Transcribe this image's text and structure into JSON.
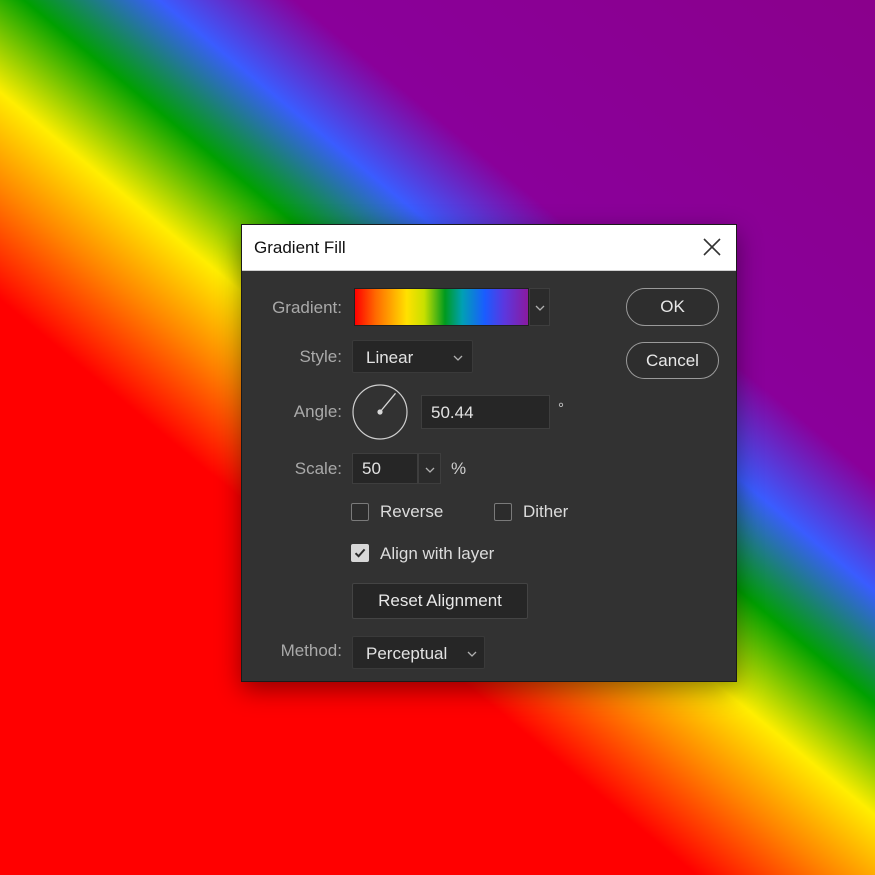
{
  "dialog": {
    "title": "Gradient Fill",
    "gradient_label": "Gradient:",
    "gradient_colors": [
      "#ff0000",
      "#ff6a00",
      "#ffe100",
      "#009a1e",
      "#1a5cff",
      "#8a1aa0"
    ],
    "style_label": "Style:",
    "style_value": "Linear",
    "angle_label": "Angle:",
    "angle_value": "50.44",
    "angle_unit": "°",
    "scale_label": "Scale:",
    "scale_value": "50",
    "scale_unit": "%",
    "reverse_label": "Reverse",
    "reverse_checked": false,
    "dither_label": "Dither",
    "dither_checked": false,
    "align_label": "Align with layer",
    "align_checked": true,
    "reset_button": "Reset Alignment",
    "method_label": "Method:",
    "method_value": "Perceptual",
    "ok_button": "OK",
    "cancel_button": "Cancel"
  },
  "icons": {
    "close": "close-icon",
    "dropdown": "chevron-down-icon",
    "check": "checkmark-icon",
    "angle": "angle-dial-icon"
  }
}
